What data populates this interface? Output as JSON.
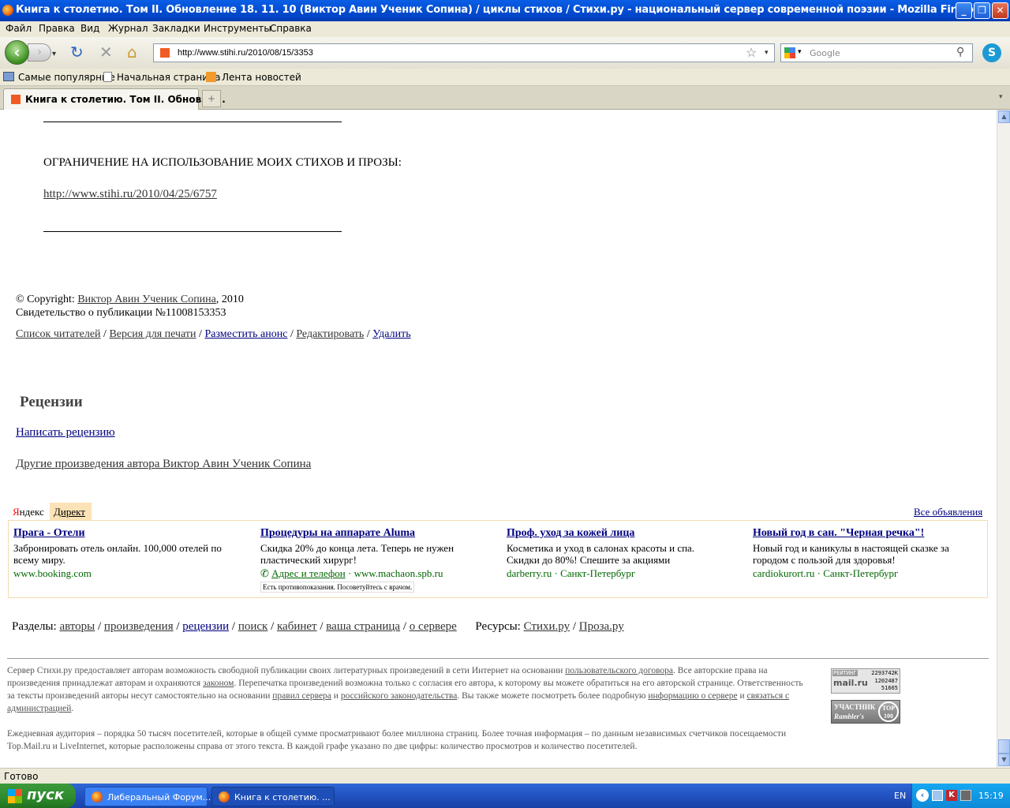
{
  "window": {
    "title": "Книга к столетию. Том II. Обновление 18. 11. 10 (Виктор Авин Ученик Сопина) / циклы стихов / Стихи.ру - национальный сервер современной поэзии - Mozilla Firefox",
    "min": "_",
    "max": "❐",
    "close": "✕"
  },
  "menu": [
    "Файл",
    "Правка",
    "Вид",
    "Журнал",
    "Закладки",
    "Инструменты",
    "Справка"
  ],
  "nav": {
    "url": "http://www.stihi.ru/2010/08/15/3353",
    "search_placeholder": "Google"
  },
  "bookmarks": [
    "Самые популярные",
    "Начальная страница",
    "Лента новостей"
  ],
  "tab": {
    "label": "Книга к столетию. Том II. Обновле...",
    "new": "+"
  },
  "page": {
    "restriction_heading": "ОГРАНИЧЕНИЕ НА ИСПОЛЬЗОВАНИЕ МОИХ СТИХОВ И ПРОЗЫ:",
    "restriction_link": "http://www.stihi.ru/2010/04/25/6757",
    "copyright_prefix": "© Copyright:",
    "author_link": "Виктор Авин Ученик Сопина",
    "copyright_year": ", 2010",
    "certificate": "Свидетельство о публикации №11008153353",
    "actions": [
      "Список читателей",
      "Версия для печати",
      "Разместить анонс",
      "Редактировать",
      "Удалить"
    ],
    "action_sep": " / ",
    "reviews_heading": "Рецензии",
    "write_review": "Написать рецензию",
    "other_works": "Другие произведения автора Виктор Авин Ученик Сопина"
  },
  "ads": {
    "yandex_ya": "Я",
    "yandex_rest": "ндекс",
    "direct": "Директ",
    "all_ads": "Все объявления",
    "items": [
      {
        "title": "Прага - Отели",
        "body": "Забронировать отель онлайн. 100,000 отелей по всему миру.",
        "url": "www.booking.com",
        "extra": "",
        "note": ""
      },
      {
        "title": "Процедуры на аппарате Aluma",
        "body": "Скидка 20% до конца лета. Теперь не нужен пластический хирург!",
        "url": "www.machaon.spb.ru",
        "extra": "Адрес и телефон",
        "note": "Есть противопоказания. Посоветуйтесь с врачом."
      },
      {
        "title": "Проф. уход за кожей лица",
        "body": "Косметика и уход в салонах красоты и спа. Скидки до 80%! Спешите за акциями",
        "url": "darberry.ru",
        "extra": "Санкт-Петербург",
        "note": ""
      },
      {
        "title": "Новый год в сан. \"Черная речка\"!",
        "body": "Новый год и каникулы в настоящей сказке за городом с пользой для здоровья!",
        "url": "cardiokurort.ru",
        "extra": "Санкт-Петербург",
        "note": ""
      }
    ]
  },
  "sections": {
    "label": "Разделы:",
    "links": [
      "авторы",
      "произведения",
      "рецензии",
      "поиск",
      "кабинет",
      "ваша страница",
      "о сервере"
    ],
    "resources_label": "Ресурсы:",
    "resources": [
      "Стихи.ру",
      "Проза.ру"
    ]
  },
  "footer": {
    "p1_a": "Сервер Стихи.ру предоставляет авторам возможность свободной публикации своих литературных произведений в сети Интернет на основании ",
    "p1_link1": "пользовательского договора",
    "p1_b": ". Все авторские права на произведения принадлежат авторам и охраняются ",
    "p1_link2": "законом",
    "p1_c": ". Перепечатка произведений возможна только с согласия его автора, к которому вы можете обратиться на его авторской странице. Ответственность за тексты произведений авторы несут самостоятельно на основании ",
    "p1_link3": "правил сервера",
    "p1_d": " и ",
    "p1_link4": "российского законодательства",
    "p1_e": ". Вы также можете посмотреть более подробную ",
    "p1_link5": "информацию о сервере",
    "p1_f": " и ",
    "p1_link6": "связаться с администрацией",
    "p1_g": ".",
    "p2": "Ежедневная аудитория – порядка 50 тысяч посетителей, которые в общей сумме просматривают более миллиона страниц. Более точная информация – по данным независимых счетчиков посещаемости Top.Mail.ru и LiveInternet, которые расположены справа от этого текста. В каждой графе указано по две цифры: количество просмотров и количество посетителей.",
    "mail_counter": {
      "label": "РЕЙТИНГ",
      "v1": "2293742K",
      "v2": "1202487",
      "v3": "51665",
      "brand": "mail.ru"
    },
    "rambler": {
      "l1": "УЧАСТНИК",
      "l2": "Rambler's",
      "badge": "TOP 100"
    }
  },
  "status": "Готово",
  "taskbar": {
    "start": "пуск",
    "items": [
      "Либеральный Форум...",
      "Книга к столетию. ..."
    ],
    "lang": "EN",
    "time": "15:19"
  }
}
